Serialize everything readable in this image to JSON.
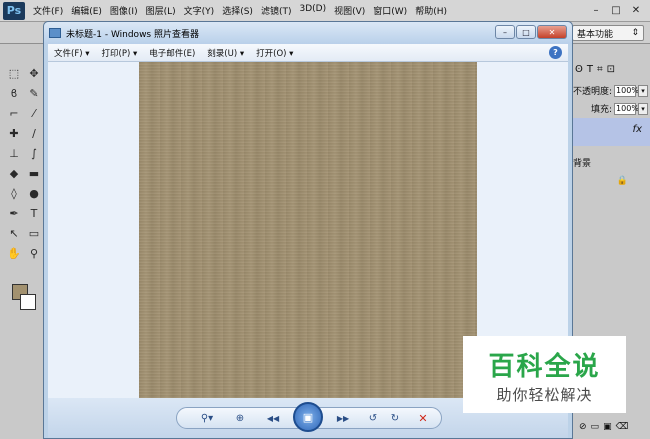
{
  "photoshop": {
    "logo": "Ps",
    "menu": [
      "文件(F)",
      "编辑(E)",
      "图像(I)",
      "图层(L)",
      "文字(Y)",
      "选择(S)",
      "滤镜(T)",
      "3D(D)",
      "视图(V)",
      "窗口(W)",
      "帮助(H)"
    ],
    "window_controls": [
      "–",
      "□",
      "✕"
    ],
    "workspace": "基本功能",
    "workspace_arrow": "⇕",
    "panel": {
      "opacity_label": "不透明度:",
      "opacity_value": "100%",
      "fill_label": "填充:",
      "fill_value": "100%",
      "layer_name": "背景",
      "fx": "fx",
      "layer_icons": [
        "ʘ",
        "T",
        "⌗",
        "⊡"
      ]
    },
    "colors": {
      "foreground": "#a2916f",
      "background": "#ffffff"
    }
  },
  "viewer": {
    "title": "未标题-1 - Windows 照片查看器",
    "title_buttons": [
      "–",
      "□",
      "✕"
    ],
    "menu": [
      {
        "label": "文件(F)",
        "arrow": "▾"
      },
      {
        "label": "打印(P)",
        "arrow": "▾"
      },
      {
        "label": "电子邮件(E)",
        "arrow": ""
      },
      {
        "label": "刻录(U)",
        "arrow": "▾"
      },
      {
        "label": "打开(O)",
        "arrow": "▾"
      }
    ],
    "help": "?",
    "toolbar": {
      "zoom": "⚲▾",
      "fit": "⊕",
      "prev": "◀◀",
      "slideshow": "▣",
      "next": "▶▶",
      "rotate_ccw": "↺",
      "rotate_cw": "↻",
      "delete": "✕"
    },
    "photo_color": "#a1906f"
  },
  "watermark": {
    "main": "百科全说",
    "sub": "助你轻松解决"
  }
}
